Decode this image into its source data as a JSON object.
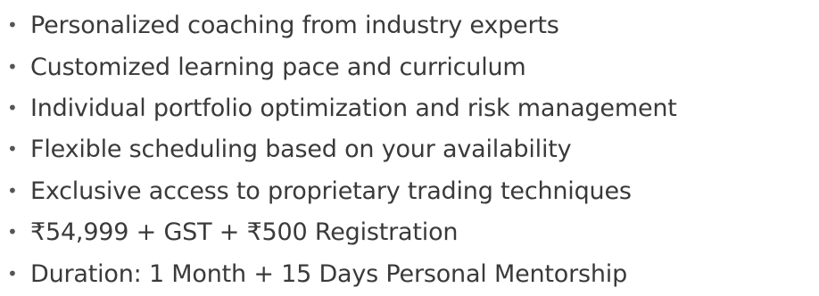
{
  "features": {
    "bullet": "•",
    "items": [
      "Personalized coaching from industry experts",
      "Customized learning pace and curriculum",
      "Individual portfolio optimization and risk management",
      "Flexible scheduling based on your availability",
      "Exclusive access to proprietary trading techniques",
      "₹54,999 + GST + ₹500 Registration",
      "Duration: 1 Month + 15 Days Personal Mentorship"
    ]
  },
  "colors": {
    "text": "#3a3a3a",
    "background": "#ffffff"
  }
}
